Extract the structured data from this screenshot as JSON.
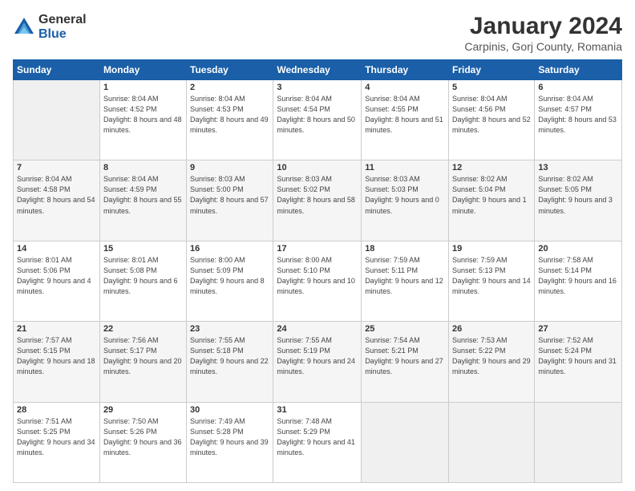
{
  "logo": {
    "general": "General",
    "blue": "Blue"
  },
  "title": "January 2024",
  "subtitle": "Carpinis, Gorj County, Romania",
  "days_of_week": [
    "Sunday",
    "Monday",
    "Tuesday",
    "Wednesday",
    "Thursday",
    "Friday",
    "Saturday"
  ],
  "weeks": [
    [
      {
        "day": "",
        "sunrise": "",
        "sunset": "",
        "daylight": ""
      },
      {
        "day": "1",
        "sunrise": "Sunrise: 8:04 AM",
        "sunset": "Sunset: 4:52 PM",
        "daylight": "Daylight: 8 hours and 48 minutes."
      },
      {
        "day": "2",
        "sunrise": "Sunrise: 8:04 AM",
        "sunset": "Sunset: 4:53 PM",
        "daylight": "Daylight: 8 hours and 49 minutes."
      },
      {
        "day": "3",
        "sunrise": "Sunrise: 8:04 AM",
        "sunset": "Sunset: 4:54 PM",
        "daylight": "Daylight: 8 hours and 50 minutes."
      },
      {
        "day": "4",
        "sunrise": "Sunrise: 8:04 AM",
        "sunset": "Sunset: 4:55 PM",
        "daylight": "Daylight: 8 hours and 51 minutes."
      },
      {
        "day": "5",
        "sunrise": "Sunrise: 8:04 AM",
        "sunset": "Sunset: 4:56 PM",
        "daylight": "Daylight: 8 hours and 52 minutes."
      },
      {
        "day": "6",
        "sunrise": "Sunrise: 8:04 AM",
        "sunset": "Sunset: 4:57 PM",
        "daylight": "Daylight: 8 hours and 53 minutes."
      }
    ],
    [
      {
        "day": "7",
        "sunrise": "Sunrise: 8:04 AM",
        "sunset": "Sunset: 4:58 PM",
        "daylight": "Daylight: 8 hours and 54 minutes."
      },
      {
        "day": "8",
        "sunrise": "Sunrise: 8:04 AM",
        "sunset": "Sunset: 4:59 PM",
        "daylight": "Daylight: 8 hours and 55 minutes."
      },
      {
        "day": "9",
        "sunrise": "Sunrise: 8:03 AM",
        "sunset": "Sunset: 5:00 PM",
        "daylight": "Daylight: 8 hours and 57 minutes."
      },
      {
        "day": "10",
        "sunrise": "Sunrise: 8:03 AM",
        "sunset": "Sunset: 5:02 PM",
        "daylight": "Daylight: 8 hours and 58 minutes."
      },
      {
        "day": "11",
        "sunrise": "Sunrise: 8:03 AM",
        "sunset": "Sunset: 5:03 PM",
        "daylight": "Daylight: 9 hours and 0 minutes."
      },
      {
        "day": "12",
        "sunrise": "Sunrise: 8:02 AM",
        "sunset": "Sunset: 5:04 PM",
        "daylight": "Daylight: 9 hours and 1 minute."
      },
      {
        "day": "13",
        "sunrise": "Sunrise: 8:02 AM",
        "sunset": "Sunset: 5:05 PM",
        "daylight": "Daylight: 9 hours and 3 minutes."
      }
    ],
    [
      {
        "day": "14",
        "sunrise": "Sunrise: 8:01 AM",
        "sunset": "Sunset: 5:06 PM",
        "daylight": "Daylight: 9 hours and 4 minutes."
      },
      {
        "day": "15",
        "sunrise": "Sunrise: 8:01 AM",
        "sunset": "Sunset: 5:08 PM",
        "daylight": "Daylight: 9 hours and 6 minutes."
      },
      {
        "day": "16",
        "sunrise": "Sunrise: 8:00 AM",
        "sunset": "Sunset: 5:09 PM",
        "daylight": "Daylight: 9 hours and 8 minutes."
      },
      {
        "day": "17",
        "sunrise": "Sunrise: 8:00 AM",
        "sunset": "Sunset: 5:10 PM",
        "daylight": "Daylight: 9 hours and 10 minutes."
      },
      {
        "day": "18",
        "sunrise": "Sunrise: 7:59 AM",
        "sunset": "Sunset: 5:11 PM",
        "daylight": "Daylight: 9 hours and 12 minutes."
      },
      {
        "day": "19",
        "sunrise": "Sunrise: 7:59 AM",
        "sunset": "Sunset: 5:13 PM",
        "daylight": "Daylight: 9 hours and 14 minutes."
      },
      {
        "day": "20",
        "sunrise": "Sunrise: 7:58 AM",
        "sunset": "Sunset: 5:14 PM",
        "daylight": "Daylight: 9 hours and 16 minutes."
      }
    ],
    [
      {
        "day": "21",
        "sunrise": "Sunrise: 7:57 AM",
        "sunset": "Sunset: 5:15 PM",
        "daylight": "Daylight: 9 hours and 18 minutes."
      },
      {
        "day": "22",
        "sunrise": "Sunrise: 7:56 AM",
        "sunset": "Sunset: 5:17 PM",
        "daylight": "Daylight: 9 hours and 20 minutes."
      },
      {
        "day": "23",
        "sunrise": "Sunrise: 7:55 AM",
        "sunset": "Sunset: 5:18 PM",
        "daylight": "Daylight: 9 hours and 22 minutes."
      },
      {
        "day": "24",
        "sunrise": "Sunrise: 7:55 AM",
        "sunset": "Sunset: 5:19 PM",
        "daylight": "Daylight: 9 hours and 24 minutes."
      },
      {
        "day": "25",
        "sunrise": "Sunrise: 7:54 AM",
        "sunset": "Sunset: 5:21 PM",
        "daylight": "Daylight: 9 hours and 27 minutes."
      },
      {
        "day": "26",
        "sunrise": "Sunrise: 7:53 AM",
        "sunset": "Sunset: 5:22 PM",
        "daylight": "Daylight: 9 hours and 29 minutes."
      },
      {
        "day": "27",
        "sunrise": "Sunrise: 7:52 AM",
        "sunset": "Sunset: 5:24 PM",
        "daylight": "Daylight: 9 hours and 31 minutes."
      }
    ],
    [
      {
        "day": "28",
        "sunrise": "Sunrise: 7:51 AM",
        "sunset": "Sunset: 5:25 PM",
        "daylight": "Daylight: 9 hours and 34 minutes."
      },
      {
        "day": "29",
        "sunrise": "Sunrise: 7:50 AM",
        "sunset": "Sunset: 5:26 PM",
        "daylight": "Daylight: 9 hours and 36 minutes."
      },
      {
        "day": "30",
        "sunrise": "Sunrise: 7:49 AM",
        "sunset": "Sunset: 5:28 PM",
        "daylight": "Daylight: 9 hours and 39 minutes."
      },
      {
        "day": "31",
        "sunrise": "Sunrise: 7:48 AM",
        "sunset": "Sunset: 5:29 PM",
        "daylight": "Daylight: 9 hours and 41 minutes."
      },
      {
        "day": "",
        "sunrise": "",
        "sunset": "",
        "daylight": ""
      },
      {
        "day": "",
        "sunrise": "",
        "sunset": "",
        "daylight": ""
      },
      {
        "day": "",
        "sunrise": "",
        "sunset": "",
        "daylight": ""
      }
    ]
  ]
}
